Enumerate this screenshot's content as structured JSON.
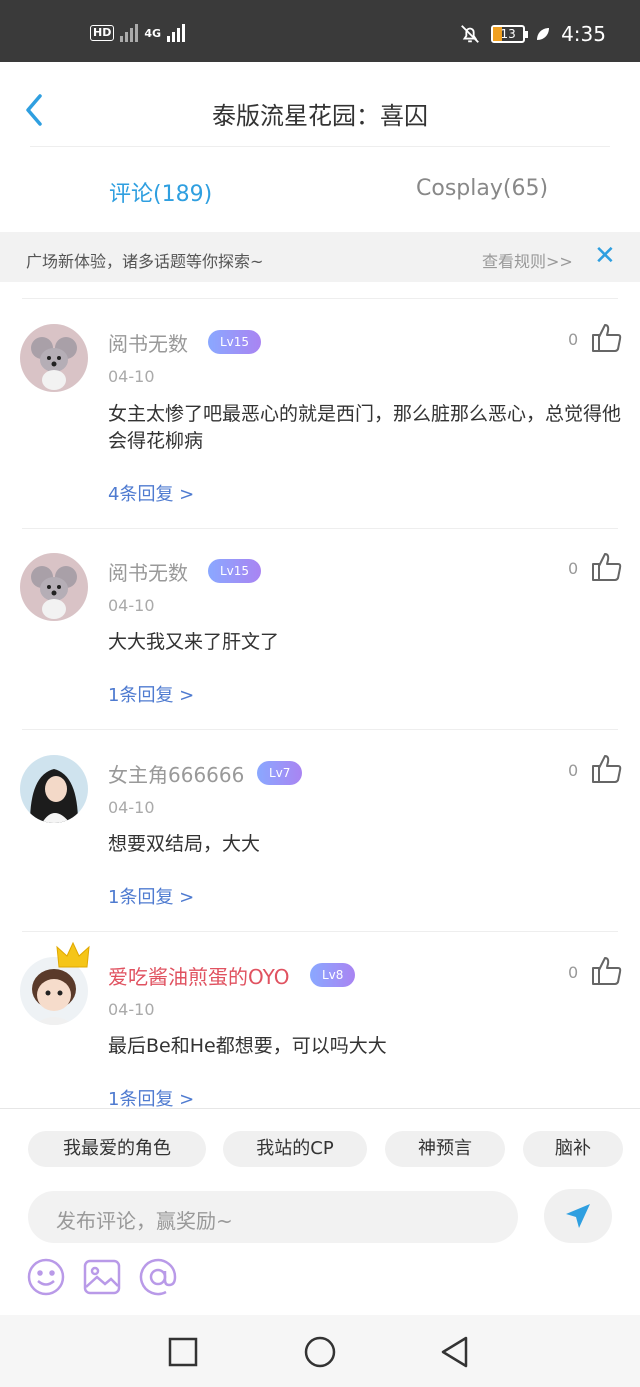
{
  "status_bar": {
    "hd": "HD",
    "network": "4G",
    "battery": "13",
    "time": "4:35"
  },
  "header": {
    "title": "泰版流星花园：喜囚"
  },
  "tabs": [
    {
      "label": "评论(189)",
      "active": true
    },
    {
      "label": "Cosplay(65)",
      "active": false
    }
  ],
  "notice": {
    "text": "广场新体验，诸多话题等你探索~",
    "link": "查看规则>>",
    "close": "✕"
  },
  "comments": [
    {
      "user": "阅书无数",
      "level": "Lv15",
      "date": "04-10",
      "likes": "0",
      "text": "女主太惨了吧最恶心的就是西门，那么脏那么恶心，总觉得他会得花柳病",
      "replies": "4条回复 >"
    },
    {
      "user": "阅书无数",
      "level": "Lv15",
      "date": "04-10",
      "likes": "0",
      "text": "大大我又来了肝文了",
      "replies": "1条回复 >"
    },
    {
      "user": "女主角666666",
      "level": "Lv7",
      "date": "04-10",
      "likes": "0",
      "text": "想要双结局，大大",
      "replies": "1条回复 >"
    },
    {
      "user": "爱吃酱油煎蛋的OYO",
      "level": "Lv8",
      "date": "04-10",
      "likes": "0",
      "text": "最后Be和He都想要，可以吗大大",
      "replies": "1条回复 >"
    }
  ],
  "composer": {
    "chips": [
      "我最爱的角色",
      "我站的CP",
      "神预言",
      "脑补"
    ],
    "placeholder": "发布评论，赢奖励~",
    "tools": [
      "emoji-icon",
      "image-icon",
      "at-icon"
    ]
  },
  "colors": {
    "accent": "#2f9fe0",
    "vip_name": "#e05260",
    "reply_link": "#4f7bd0"
  }
}
